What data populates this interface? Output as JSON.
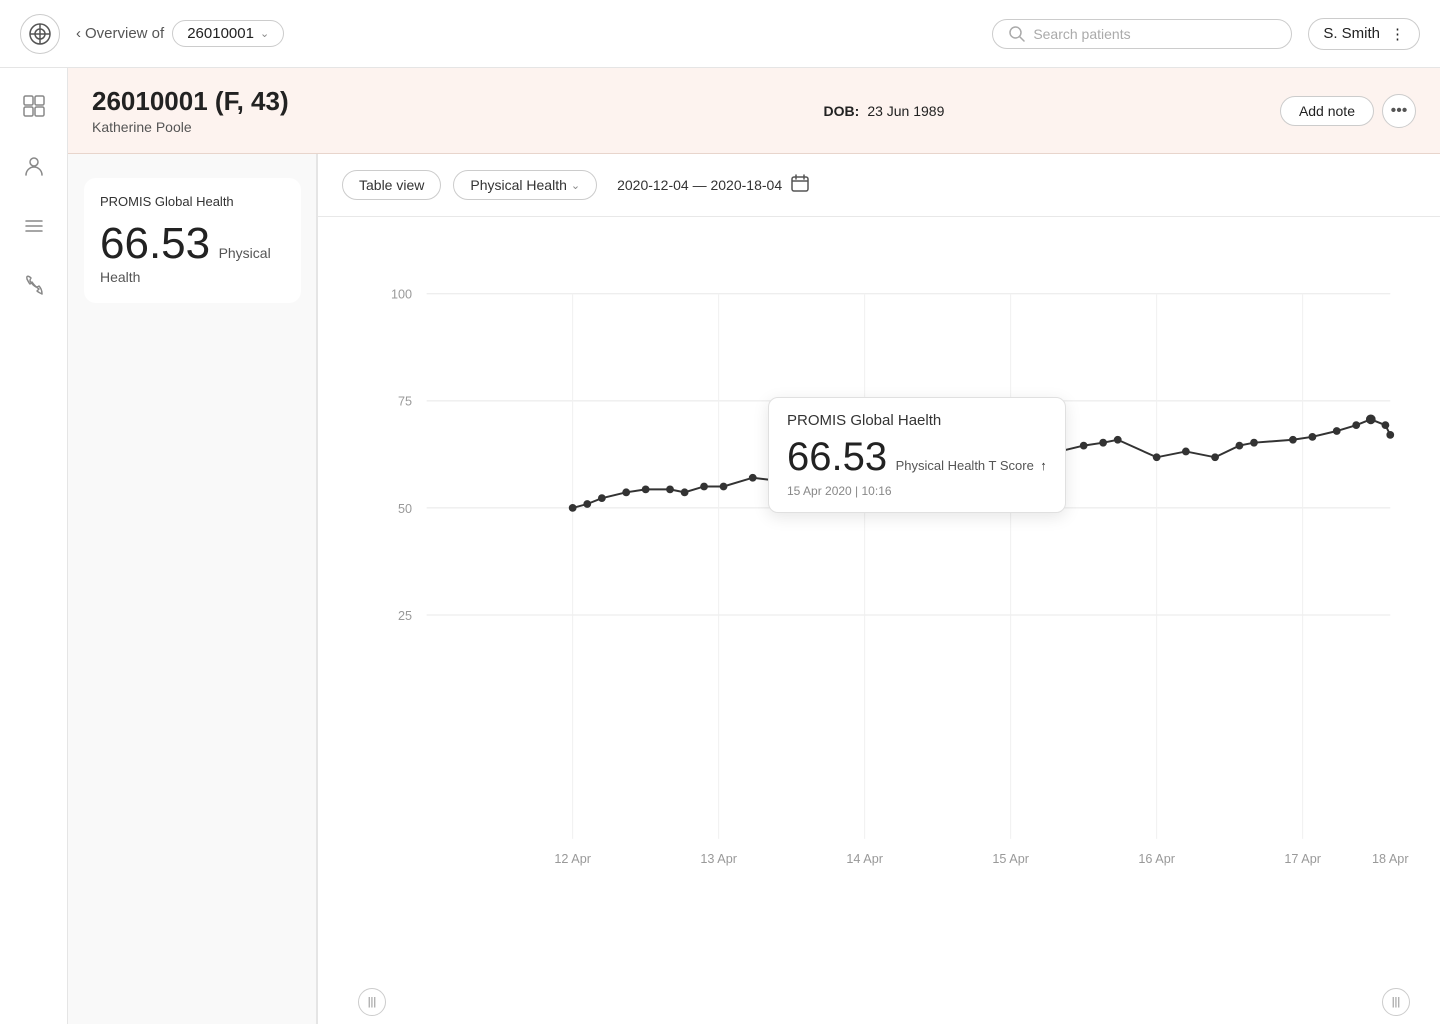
{
  "app": {
    "logo": "⊕",
    "overview_label": "Overview of"
  },
  "nav": {
    "patient_id": "26010001",
    "chevron": "∨",
    "search_placeholder": "Search patients",
    "user_name": "S. Smith",
    "more_dots": "⋮"
  },
  "patient": {
    "id": "26010001",
    "gender": "F",
    "age": "43",
    "name": "Katherine Poole",
    "dob_label": "DOB:",
    "dob_value": "23 Jun 1989"
  },
  "buttons": {
    "add_note": "Add note",
    "table_view": "Table view",
    "physical_health": "Physical Health",
    "date_range": "2020-12-04 — 2020-18-04"
  },
  "sidebar": {
    "metric_card_title": "PROMIS Global Health",
    "metric_value": "66.53",
    "metric_label": "Physical Health"
  },
  "tooltip": {
    "title": "PROMIS Global Haelth",
    "value": "66.53",
    "sublabel": "Physical Health T Score",
    "arrow": "↑",
    "date": "15 Apr 2020 | 10:16"
  },
  "chart": {
    "y_labels": [
      "100",
      "75",
      "50",
      "25"
    ],
    "x_labels": [
      "12 Apr",
      "13 Apr",
      "14 Apr",
      "15 Apr",
      "16 Apr",
      "17 Apr",
      "18 Apr"
    ],
    "scroll_left": "|||",
    "scroll_right": "|||"
  },
  "icons": {
    "back_arrow": "‹",
    "search": "🔍",
    "gallery": "⊞",
    "person": "👤",
    "list": "≡",
    "phone": "📞",
    "calendar": "🗓",
    "chevron_down": "⌄"
  }
}
